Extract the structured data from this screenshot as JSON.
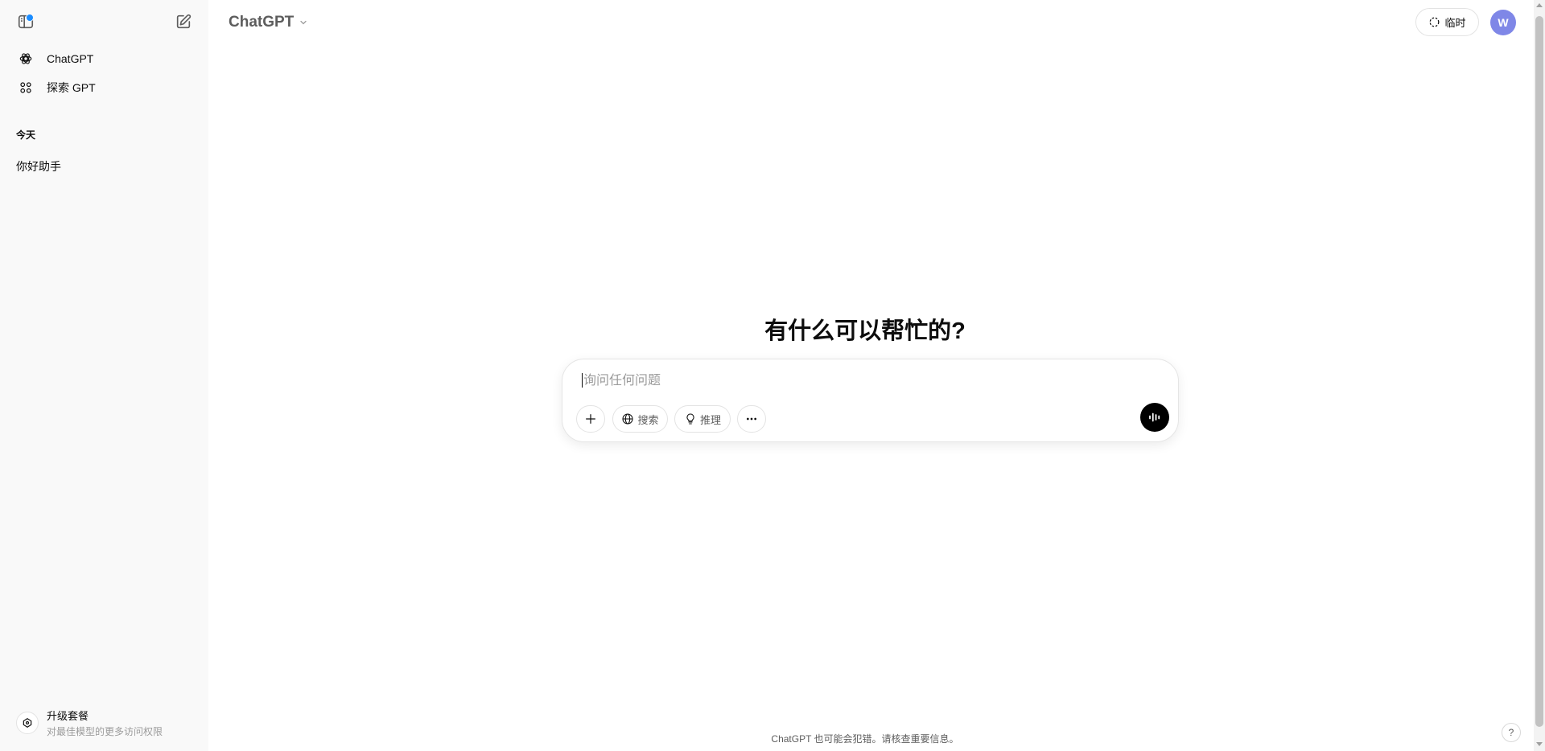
{
  "sidebar": {
    "nav": [
      {
        "label": "ChatGPT",
        "icon": "openai-logo-icon"
      },
      {
        "label": "探索 GPT",
        "icon": "grid-icon"
      }
    ],
    "section_title": "今天",
    "history": [
      {
        "label": "你好助手"
      }
    ],
    "upgrade": {
      "title": "升级套餐",
      "subtitle": "对最佳模型的更多访问权限"
    }
  },
  "header": {
    "model_label": "ChatGPT",
    "temp_label": "临时",
    "avatar_letter": "W"
  },
  "main": {
    "headline": "有什么可以帮忙的?",
    "composer": {
      "placeholder": "询问任何问题",
      "search_label": "搜索",
      "reason_label": "推理"
    },
    "footer_note": "ChatGPT 也可能会犯错。请核查重要信息。",
    "help_label": "?"
  },
  "colors": {
    "avatar_bg": "#7f87e7",
    "notif_dot": "#1a8cff",
    "sidebar_bg": "#f9f9f9"
  }
}
